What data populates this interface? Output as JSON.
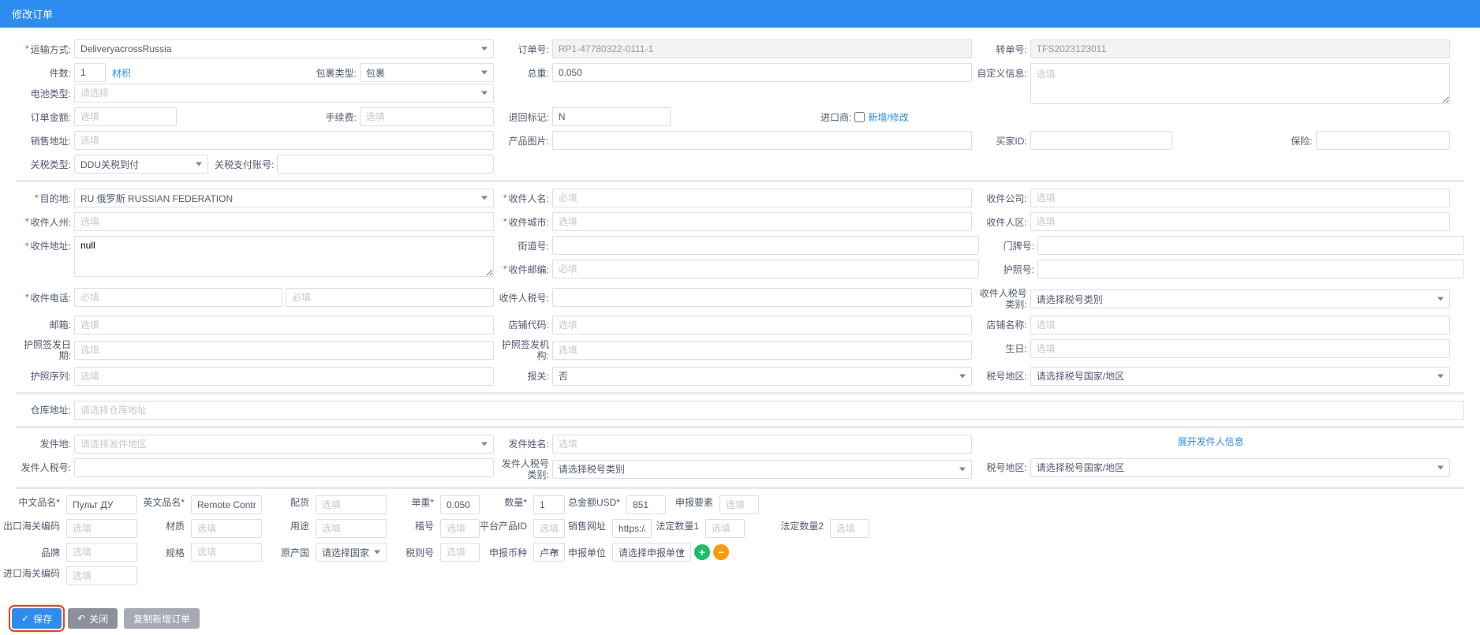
{
  "header": {
    "title": "修改订单"
  },
  "placeholders": {
    "select": "请选择",
    "optional": "选填",
    "required": "必填"
  },
  "section1": {
    "shipMethod": {
      "label": "运输方式:",
      "value": "DeliveryacrossRussia"
    },
    "orderNo": {
      "label": "订单号:",
      "value": "RP1-47780322-0111-1"
    },
    "refNo": {
      "label": "转单号:",
      "value": "TFS2023123011"
    },
    "pieces": {
      "label": "件数:",
      "value": "1"
    },
    "volume": {
      "label": "材积"
    },
    "packageType": {
      "label": "包裹类型:",
      "value": "包裹"
    },
    "weight": {
      "label": "总重:",
      "value": "0.050"
    },
    "customInfo": {
      "label": "自定义信息:"
    },
    "batteryType": {
      "label": "电池类型:"
    },
    "orderAmount": {
      "label": "订单金额:"
    },
    "fee": {
      "label": "手续费:"
    },
    "returnFlag": {
      "label": "退回标记:",
      "value": "N"
    },
    "importer": {
      "label": "进口商:",
      "addEdit": "新增/修改"
    },
    "salesAddr": {
      "label": "销售地址:"
    },
    "productImage": {
      "label": "产品图片:"
    },
    "buyerId": {
      "label": "买家ID:"
    },
    "insurance": {
      "label": "保险:"
    },
    "dutyType": {
      "label": "关税类型:",
      "value": "DDU关税到付"
    },
    "dutyAccount": {
      "label": "关税支付账号:"
    }
  },
  "section2": {
    "destination": {
      "label": "目的地:",
      "value": "RU 俄罗斯 RUSSIAN FEDERATION"
    },
    "recipientName": {
      "label": "收件人名:"
    },
    "recipientCompany": {
      "label": "收件公司:"
    },
    "recipientState": {
      "label": "收件人州:"
    },
    "recipientCity": {
      "label": "收件城市:"
    },
    "recipientDistrict": {
      "label": "收件人区:"
    },
    "recipientAddr": {
      "label": "收件地址:",
      "value": "null"
    },
    "streetNo": {
      "label": "街道号:"
    },
    "doorNo": {
      "label": "门牌号:"
    },
    "postcode": {
      "label": "收件邮编:"
    },
    "passportNo": {
      "label": "护照号:"
    },
    "phone": {
      "label": "收件电话:"
    },
    "taxNo": {
      "label": "收件人税号:"
    },
    "taxType": {
      "label": "收件人税号类别:",
      "value": "请选择税号类别"
    },
    "email": {
      "label": "邮箱:"
    },
    "storeCode": {
      "label": "店铺代码:"
    },
    "storeName": {
      "label": "店铺名称:"
    },
    "passportDate": {
      "label": "护照签发日期:"
    },
    "passportOrg": {
      "label": "护照签发机构:"
    },
    "birthday": {
      "label": "生日:"
    },
    "passportSerial": {
      "label": "护照序列:"
    },
    "customs": {
      "label": "报关:",
      "value": "否"
    },
    "taxRegion": {
      "label": "税号地区:",
      "value": "请选择税号国家/地区"
    }
  },
  "section3": {
    "warehouseAddr": {
      "label": "仓库地址:",
      "value": "请选择仓库地址"
    }
  },
  "section4": {
    "shipFrom": {
      "label": "发件地:",
      "value": "请选择发件地区"
    },
    "senderName": {
      "label": "发件姓名:"
    },
    "expand": "展开发件人信息",
    "senderTaxNo": {
      "label": "发件人税号:"
    },
    "senderTaxType": {
      "label": "发件人税号类别:",
      "value": "请选择税号类别"
    },
    "senderTaxRegion": {
      "label": "税号地区:",
      "value": "请选择税号国家/地区"
    }
  },
  "product": {
    "cnName": {
      "label": "中文品名*",
      "value": "Пульт ДУ"
    },
    "enName": {
      "label": "英文品名*",
      "value": "Remote Control"
    },
    "stock": {
      "label": "配货"
    },
    "unitWeight": {
      "label": "单重*",
      "value": "0.050"
    },
    "qty": {
      "label": "数量*",
      "value": "1"
    },
    "totalUSD": {
      "label": "总金额USD*",
      "value": "851"
    },
    "declareElement": {
      "label": "申报要素"
    },
    "exportHS": {
      "label": "出口海关编码"
    },
    "material": {
      "label": "材质"
    },
    "usage": {
      "label": "用途"
    },
    "hsExtra": {
      "label": "稽号"
    },
    "platformId": {
      "label": "平台产品ID"
    },
    "salesUrl": {
      "label": "销售网址",
      "value": "https://ww"
    },
    "legalQty1": {
      "label": "法定数量1"
    },
    "legalQty2": {
      "label": "法定数量2"
    },
    "brand": {
      "label": "品牌"
    },
    "spec": {
      "label": "规格"
    },
    "origin": {
      "label": "原产国",
      "value": "请选择国家"
    },
    "taxCode": {
      "label": "税则号"
    },
    "currency": {
      "label": "申报币种",
      "value": "卢布"
    },
    "declareUnit": {
      "label": "申报单位",
      "value": "请选择申报单位"
    },
    "importHS": {
      "label": "进口海关编码"
    }
  },
  "footer": {
    "save": "保存",
    "close": "关闭",
    "copy": "复制新增订单"
  }
}
